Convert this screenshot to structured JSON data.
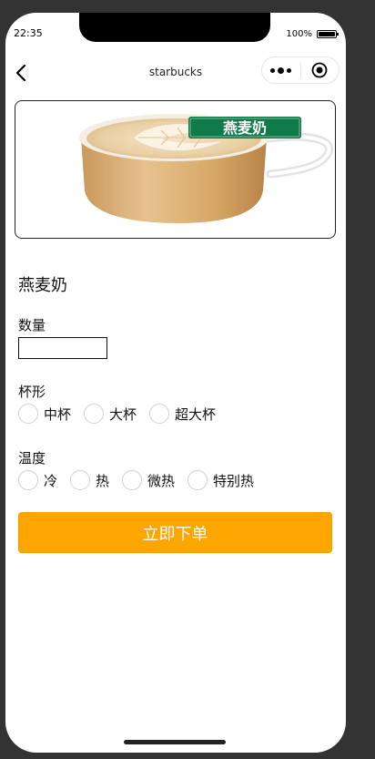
{
  "status_bar": {
    "time": "22:35",
    "battery_percent": "100%",
    "battery_level": 1.0
  },
  "nav": {
    "title": "starbucks"
  },
  "product": {
    "image_badge": "燕麦奶",
    "name": "燕麦奶"
  },
  "quantity": {
    "label": "数量",
    "value": "",
    "placeholder": ""
  },
  "cup_size": {
    "label": "杯形",
    "options": [
      "中杯",
      "大杯",
      "超大杯"
    ]
  },
  "temperature": {
    "label": "温度",
    "options": [
      "冷",
      "热",
      "微热",
      "特别热"
    ]
  },
  "actions": {
    "order_label": "立即下单"
  },
  "colors": {
    "accent": "#FFA500",
    "badge_green": "#0f7a4a"
  }
}
